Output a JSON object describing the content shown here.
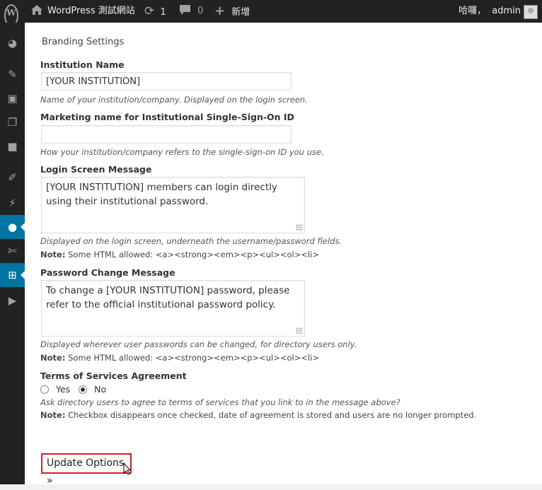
{
  "adminbar": {
    "logo_icon": "wordpress-logo-icon",
    "site_name": "WordPress 測試網站",
    "updates_count": "1",
    "comments_count": "0",
    "new_label": "新增",
    "greeting": "哈囉，",
    "username": "admin"
  },
  "sidebar": {
    "icons": [
      "dashboard-icon",
      "pin-icon",
      "media-icon",
      "pages-icon",
      "comments-icon",
      "appearance-icon",
      "plugins-icon",
      "users-icon",
      "tools-icon",
      "settings-icon",
      "play-icon"
    ],
    "active": "users-icon"
  },
  "form": {
    "section_title": "Branding Settings",
    "institution_name": {
      "label": "Institution Name",
      "value": "[YOUR INSTITUTION]",
      "description": "Name of your institution/company. Displayed on the login screen."
    },
    "marketing_name": {
      "label": "Marketing name for Institutional Single-Sign-On ID",
      "value": "",
      "description": "How your institution/company refers to the single-sign-on ID you use."
    },
    "login_message": {
      "label": "Login Screen Message",
      "value": "[YOUR INSTITUTION] members can login directly using their institutional password.",
      "description": "Displayed on the login screen, underneath the username/password fields.",
      "note_label": "Note:",
      "note_text": " Some HTML allowed: <a><strong><em><p><ul><ol><li>"
    },
    "password_message": {
      "label": "Password Change Message",
      "value": "To change a [YOUR INSTITUTION] password, please refer to the official institutional password policy.",
      "description": "Displayed wherever user passwords can be changed, for directory users only.",
      "note_label": "Note:",
      "note_text": " Some HTML allowed: <a><strong><em><p><ul><ol><li>"
    },
    "tos": {
      "label": "Terms of Services Agreement",
      "yes_label": "Yes",
      "no_label": "No",
      "selected": "No",
      "description": "Ask directory users to agree to terms of services that you link to in the message above?",
      "note_label": "Note:",
      "note_text": " Checkbox disappears once checked, date of agreement is stored and users are no longer prompted."
    },
    "submit_label": "Update Options »"
  },
  "colors": {
    "adminbar_bg": "#222222",
    "active_menu": "#0074a2",
    "highlight_border": "#d81b2b"
  }
}
